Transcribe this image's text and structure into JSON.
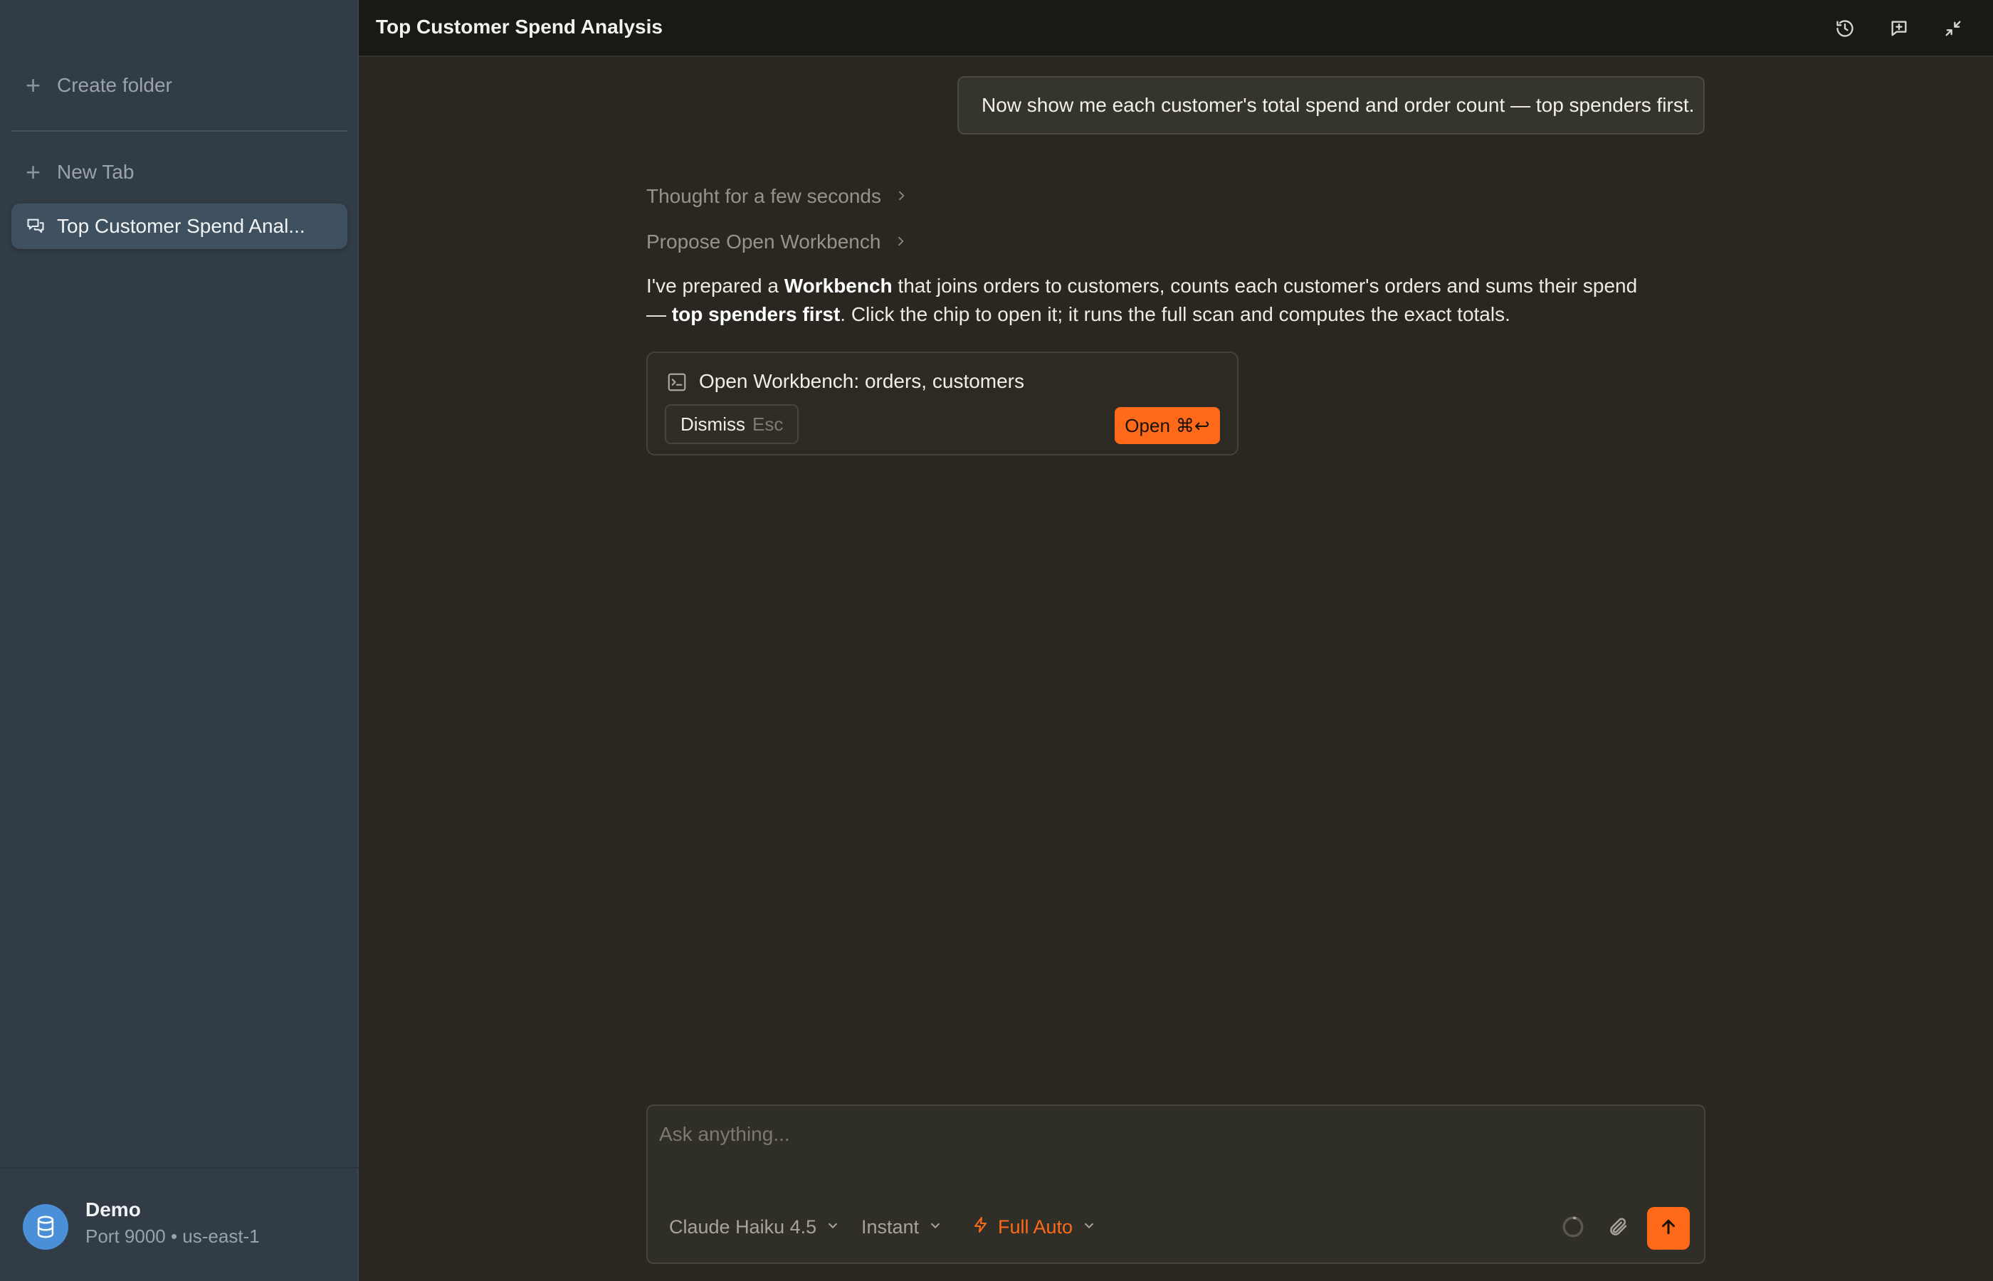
{
  "sidebar": {
    "create_folder_label": "Create folder",
    "new_tab_label": "New Tab",
    "active_tab_label": "Top Customer Spend Anal...",
    "database": {
      "name": "Demo",
      "meta": "Port 9000 • us-east-1"
    }
  },
  "header": {
    "title": "Top Customer Spend Analysis",
    "icons": [
      "history-icon",
      "new-chat-icon",
      "collapse-icon"
    ]
  },
  "conversation": {
    "user_message": "Now show me each customer's total spend and order count — top spenders first.",
    "thought_label": "Thought for a few seconds",
    "propose_label": "Propose Open Workbench",
    "answer": {
      "p1": "I've prepared a ",
      "b1": "Workbench",
      "p2": " that joins orders to customers, counts each customer's orders and sums their spend — ",
      "b2": "top spenders first",
      "p3": ". Click the chip to open it; it runs the full scan and computes the exact totals."
    },
    "chip": {
      "title": "Open Workbench: orders, customers",
      "dismiss_label": "Dismiss",
      "dismiss_key": "Esc",
      "open_label": "Open",
      "open_key": "⌘↩"
    }
  },
  "composer": {
    "placeholder": "Ask anything...",
    "model": "Claude Haiku 4.5",
    "speed": "Instant",
    "mode": "Full Auto"
  },
  "colors": {
    "accent": "#ff6a1a",
    "sidebar_bg": "#323c46",
    "main_bg": "#2a2720"
  }
}
